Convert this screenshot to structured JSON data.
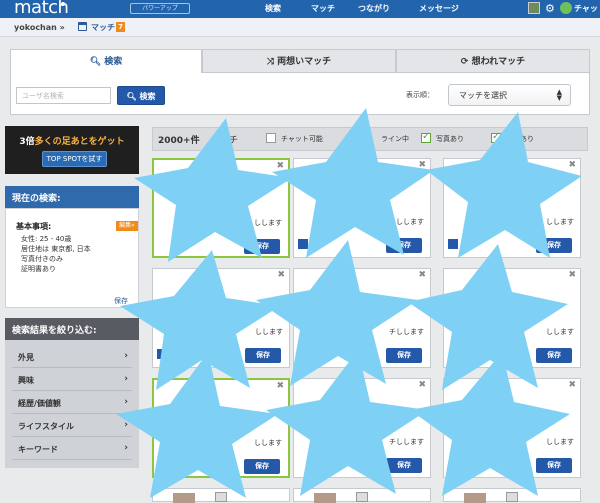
{
  "topbar": {
    "logo": "match",
    "powerup": "パワーアップ",
    "nav": [
      "検索",
      "マッチ",
      "つながり",
      "メッセージ"
    ],
    "chat": "チャッ"
  },
  "subbar": {
    "username": "yokochan »",
    "match": "マッチ",
    "match_count": "7"
  },
  "tabs": [
    {
      "label": "検索",
      "icon": "search-icon"
    },
    {
      "label": "両想いマッチ",
      "icon": "arrows-icon"
    },
    {
      "label": "想われマッチ",
      "icon": "cycle-icon"
    }
  ],
  "search": {
    "placeholder": "ユーザ名検索",
    "button": "検索",
    "sort_label": "表示順：",
    "sort_value": "マッチを選択"
  },
  "promo": {
    "pre": "3倍",
    "highlight": "多くの足あとをゲット",
    "button": "TOP SPOTを試す"
  },
  "current": {
    "heading": "現在の検索:",
    "title": "基本事項:",
    "edit": "編集»",
    "lines": [
      "女性: 25 - 40歳",
      "居住地は 東京都, 日本",
      "写真付きのみ",
      "証明書あり"
    ],
    "save": "保存"
  },
  "refine": {
    "heading": "検索結果を絞り込む:",
    "items": [
      "外見",
      "興味",
      "経歴/価値観",
      "ライフスタイル",
      "キーワード"
    ]
  },
  "filters": {
    "count": "2000+件",
    "count_tail": "チ",
    "options": [
      {
        "label": "チャット可能",
        "checked": false
      },
      {
        "label": "ライン中",
        "checked": true
      },
      {
        "label": "写真あり",
        "checked": true
      },
      {
        "label": "明書あり",
        "checked": true
      }
    ]
  },
  "cards": {
    "message": "しします",
    "message_alt": "チしします",
    "save": "保存",
    "close": "✖"
  },
  "colors": {
    "star": "#7fd0f5",
    "brand": "#2265ad",
    "accent": "#f08a1a",
    "green": "#8cc63f"
  }
}
